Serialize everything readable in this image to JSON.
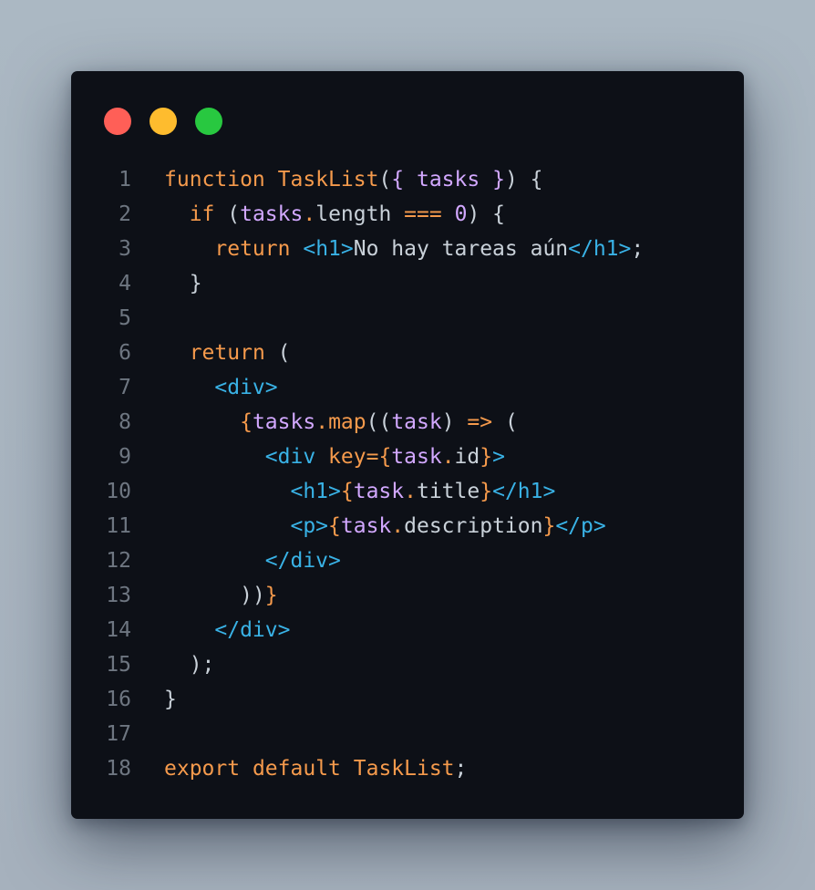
{
  "window": {
    "dots": [
      {
        "name": "close",
        "color": "#ff5f57"
      },
      {
        "name": "minimize",
        "color": "#febc2e"
      },
      {
        "name": "maximize",
        "color": "#28c840"
      }
    ]
  },
  "colors": {
    "background": "#a9b5c1",
    "editor_bg": "#0d1017",
    "line_number": "#6e7681",
    "keyword": "#f59a4c",
    "variable": "#d2a8ff",
    "tag": "#39b2e6",
    "text": "#c9d1d9"
  },
  "code": {
    "lines": [
      {
        "n": "1",
        "tokens": [
          {
            "t": "function",
            "k": "keyword"
          },
          {
            "t": " ",
            "k": "text"
          },
          {
            "t": "TaskList",
            "k": "func"
          },
          {
            "t": "(",
            "k": "punc"
          },
          {
            "t": "{",
            "k": "var"
          },
          {
            "t": " tasks ",
            "k": "var"
          },
          {
            "t": "}",
            "k": "var"
          },
          {
            "t": ") {",
            "k": "punc"
          }
        ]
      },
      {
        "n": "2",
        "tokens": [
          {
            "t": "  ",
            "k": "text"
          },
          {
            "t": "if",
            "k": "keyword"
          },
          {
            "t": " (",
            "k": "punc"
          },
          {
            "t": "tasks",
            "k": "var"
          },
          {
            "t": ".",
            "k": "dot"
          },
          {
            "t": "length",
            "k": "prop"
          },
          {
            "t": " ",
            "k": "text"
          },
          {
            "t": "===",
            "k": "op"
          },
          {
            "t": " ",
            "k": "text"
          },
          {
            "t": "0",
            "k": "num"
          },
          {
            "t": ") {",
            "k": "punc"
          }
        ]
      },
      {
        "n": "3",
        "tokens": [
          {
            "t": "    ",
            "k": "text"
          },
          {
            "t": "return",
            "k": "keyword"
          },
          {
            "t": " ",
            "k": "text"
          },
          {
            "t": "<h1>",
            "k": "tag"
          },
          {
            "t": "No hay tareas aún",
            "k": "text"
          },
          {
            "t": "</h1>",
            "k": "tag"
          },
          {
            "t": ";",
            "k": "punc"
          }
        ]
      },
      {
        "n": "4",
        "tokens": [
          {
            "t": "  }",
            "k": "punc"
          }
        ]
      },
      {
        "n": "5",
        "tokens": []
      },
      {
        "n": "6",
        "tokens": [
          {
            "t": "  ",
            "k": "text"
          },
          {
            "t": "return",
            "k": "keyword"
          },
          {
            "t": " (",
            "k": "punc"
          }
        ]
      },
      {
        "n": "7",
        "tokens": [
          {
            "t": "    ",
            "k": "text"
          },
          {
            "t": "<div>",
            "k": "tag"
          }
        ]
      },
      {
        "n": "8",
        "tokens": [
          {
            "t": "      ",
            "k": "text"
          },
          {
            "t": "{",
            "k": "jsx"
          },
          {
            "t": "tasks",
            "k": "var"
          },
          {
            "t": ".",
            "k": "dot"
          },
          {
            "t": "map",
            "k": "func"
          },
          {
            "t": "((",
            "k": "punc"
          },
          {
            "t": "task",
            "k": "var"
          },
          {
            "t": ") ",
            "k": "punc"
          },
          {
            "t": "=>",
            "k": "op"
          },
          {
            "t": " (",
            "k": "punc"
          }
        ]
      },
      {
        "n": "9",
        "tokens": [
          {
            "t": "        ",
            "k": "text"
          },
          {
            "t": "<div",
            "k": "tag"
          },
          {
            "t": " ",
            "k": "text"
          },
          {
            "t": "key",
            "k": "attr"
          },
          {
            "t": "=",
            "k": "op"
          },
          {
            "t": "{",
            "k": "jsx"
          },
          {
            "t": "task",
            "k": "var"
          },
          {
            "t": ".",
            "k": "dot"
          },
          {
            "t": "id",
            "k": "prop"
          },
          {
            "t": "}",
            "k": "jsx"
          },
          {
            "t": ">",
            "k": "tag"
          }
        ]
      },
      {
        "n": "10",
        "tokens": [
          {
            "t": "          ",
            "k": "text"
          },
          {
            "t": "<h1>",
            "k": "tag"
          },
          {
            "t": "{",
            "k": "jsx"
          },
          {
            "t": "task",
            "k": "var"
          },
          {
            "t": ".",
            "k": "dot"
          },
          {
            "t": "title",
            "k": "prop"
          },
          {
            "t": "}",
            "k": "jsx"
          },
          {
            "t": "</h1>",
            "k": "tag"
          }
        ]
      },
      {
        "n": "11",
        "tokens": [
          {
            "t": "          ",
            "k": "text"
          },
          {
            "t": "<p>",
            "k": "tag"
          },
          {
            "t": "{",
            "k": "jsx"
          },
          {
            "t": "task",
            "k": "var"
          },
          {
            "t": ".",
            "k": "dot"
          },
          {
            "t": "description",
            "k": "prop"
          },
          {
            "t": "}",
            "k": "jsx"
          },
          {
            "t": "</p>",
            "k": "tag"
          }
        ]
      },
      {
        "n": "12",
        "tokens": [
          {
            "t": "        ",
            "k": "text"
          },
          {
            "t": "</div>",
            "k": "tag"
          }
        ]
      },
      {
        "n": "13",
        "tokens": [
          {
            "t": "      ",
            "k": "text"
          },
          {
            "t": "))",
            "k": "punc"
          },
          {
            "t": "}",
            "k": "jsx"
          }
        ]
      },
      {
        "n": "14",
        "tokens": [
          {
            "t": "    ",
            "k": "text"
          },
          {
            "t": "</div>",
            "k": "tag"
          }
        ]
      },
      {
        "n": "15",
        "tokens": [
          {
            "t": "  );",
            "k": "punc"
          }
        ]
      },
      {
        "n": "16",
        "tokens": [
          {
            "t": "}",
            "k": "punc"
          }
        ]
      },
      {
        "n": "17",
        "tokens": []
      },
      {
        "n": "18",
        "tokens": [
          {
            "t": "export",
            "k": "keyword"
          },
          {
            "t": " ",
            "k": "text"
          },
          {
            "t": "default",
            "k": "keyword"
          },
          {
            "t": " ",
            "k": "text"
          },
          {
            "t": "TaskList",
            "k": "func"
          },
          {
            "t": ";",
            "k": "punc"
          }
        ]
      }
    ]
  }
}
